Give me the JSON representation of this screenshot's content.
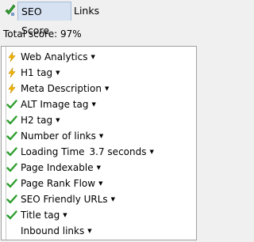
{
  "tabs": {
    "seo_score": "SEO Score",
    "links": "Links"
  },
  "total_score": "Total score: 97%",
  "rows": [
    {
      "label": "Web Analytics",
      "status": "warning"
    },
    {
      "label": "H1 tag",
      "status": "warning"
    },
    {
      "label": "Meta Description",
      "status": "warning"
    },
    {
      "label": "ALT Image tag",
      "status": "pass"
    },
    {
      "label": "H2 tag",
      "status": "pass"
    },
    {
      "label": "Number of links",
      "status": "pass"
    },
    {
      "label": "Loading Time",
      "extra": "3.7 seconds",
      "status": "pass"
    },
    {
      "label": "Page Indexable",
      "status": "pass"
    },
    {
      "label": "Page Rank Flow",
      "status": "pass"
    },
    {
      "label": "SEO Friendly URLs",
      "status": "pass"
    },
    {
      "label": "Title tag",
      "status": "pass"
    },
    {
      "label": "Inbound links",
      "status": "none"
    }
  ],
  "caret_glyph": "▼",
  "colors": {
    "pass": "#2e9e2e",
    "warning": "#e8a800",
    "active_tab_bg": "#d6e2f2"
  },
  "icons": {
    "pass": "check-icon",
    "warning": "lightning-icon"
  }
}
